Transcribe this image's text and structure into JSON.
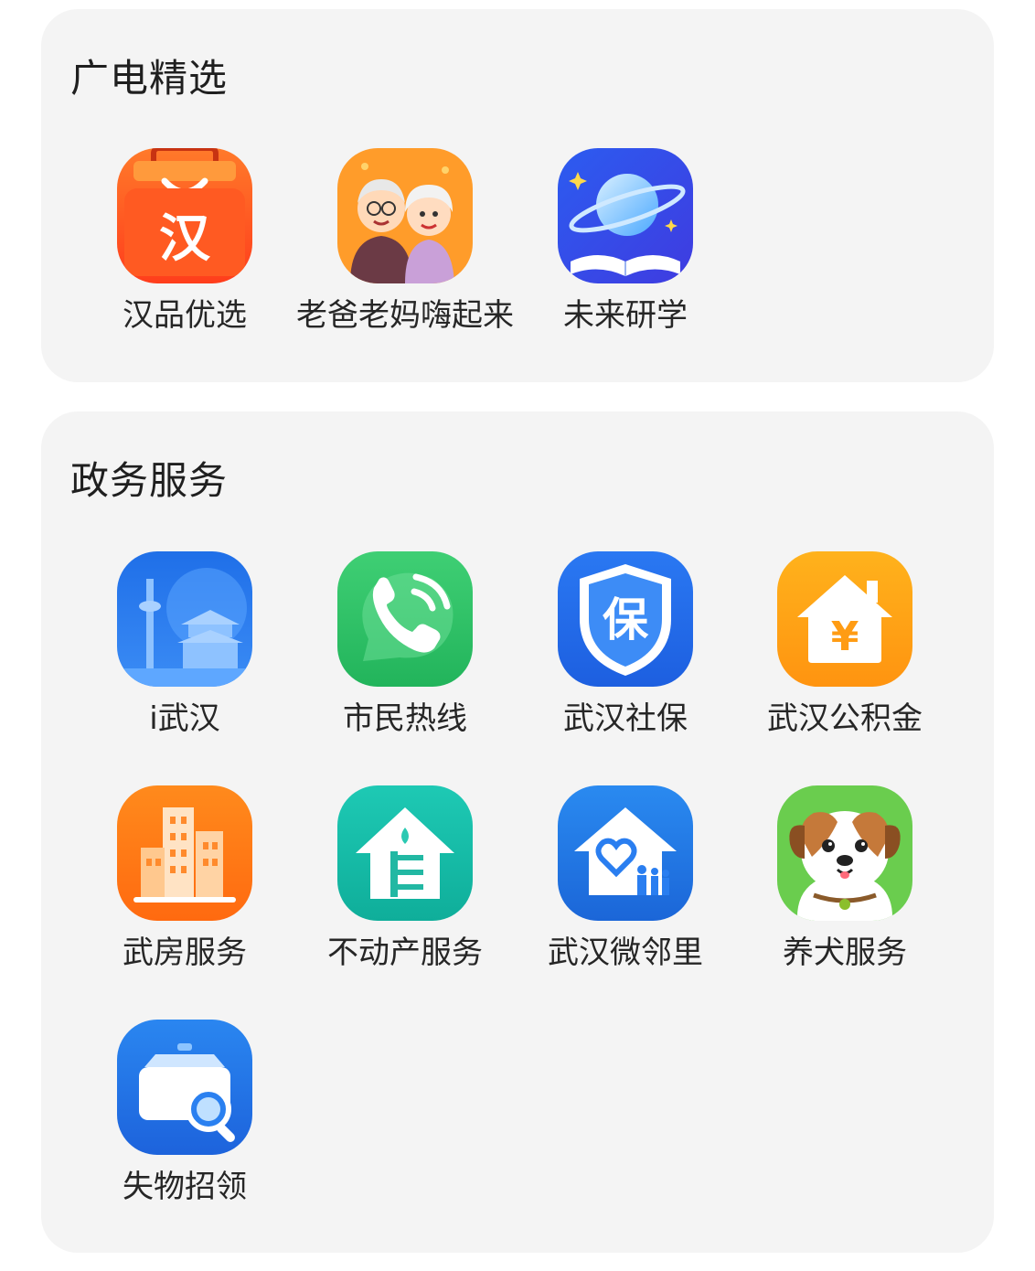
{
  "sections": [
    {
      "title": "广电精选",
      "apps": [
        {
          "label": "汉品优选",
          "icon": "shopping-bag-han-icon"
        },
        {
          "label": "老爸老妈嗨起来",
          "icon": "elderly-couple-icon"
        },
        {
          "label": "未来研学",
          "icon": "planet-book-icon"
        }
      ]
    },
    {
      "title": "政务服务",
      "apps": [
        {
          "label": "i武汉",
          "icon": "city-skyline-icon"
        },
        {
          "label": "市民热线",
          "icon": "phone-call-icon"
        },
        {
          "label": "武汉社保",
          "icon": "shield-bao-icon"
        },
        {
          "label": "武汉公积金",
          "icon": "house-yuan-icon"
        },
        {
          "label": "武房服务",
          "icon": "buildings-icon"
        },
        {
          "label": "不动产服务",
          "icon": "house-deed-icon"
        },
        {
          "label": "武汉微邻里",
          "icon": "neighborhood-heart-icon"
        },
        {
          "label": "养犬服务",
          "icon": "dog-face-icon"
        },
        {
          "label": "失物招领",
          "icon": "lost-box-search-icon"
        }
      ]
    }
  ],
  "icon_glyphs": {
    "han": "汉",
    "bao": "保",
    "yuan": "¥"
  }
}
